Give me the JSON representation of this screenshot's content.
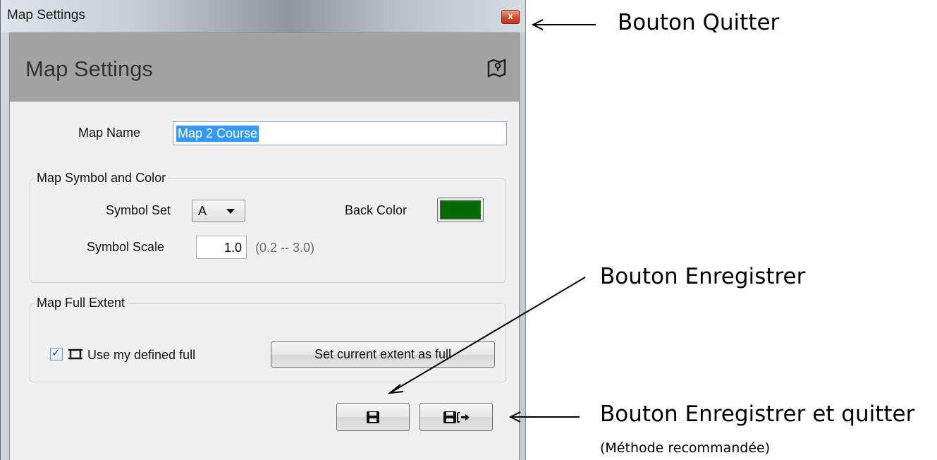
{
  "window": {
    "title": "Map Settings",
    "close_glyph": "x"
  },
  "header": {
    "title": "Map Settings",
    "icon": "map-icon"
  },
  "form": {
    "map_name_label": "Map Name",
    "map_name_value": "Map 2 Course",
    "symbol_group": {
      "title": "Map Symbol and Color",
      "symbol_set_label": "Symbol Set",
      "symbol_set_value": "A",
      "back_color_label": "Back Color",
      "back_color": "#036b03",
      "symbol_scale_label": "Symbol Scale",
      "symbol_scale_value": "1.0",
      "symbol_scale_range": "(0.2 -- 3.0)"
    },
    "extent_group": {
      "title": "Map Full Extent",
      "use_defined_label": "Use my defined full",
      "use_defined_checked": true,
      "set_current_button": "Set current extent as full"
    }
  },
  "footer": {
    "save_icon": "floppy-disk-icon",
    "save_exit_icon": "floppy-disk-exit-icon"
  },
  "annotations": {
    "quit": "Bouton Quitter",
    "save": "Bouton Enregistrer",
    "save_quit": "Bouton Enregistrer et quitter",
    "save_quit_note": "(Méthode recommandée)"
  }
}
